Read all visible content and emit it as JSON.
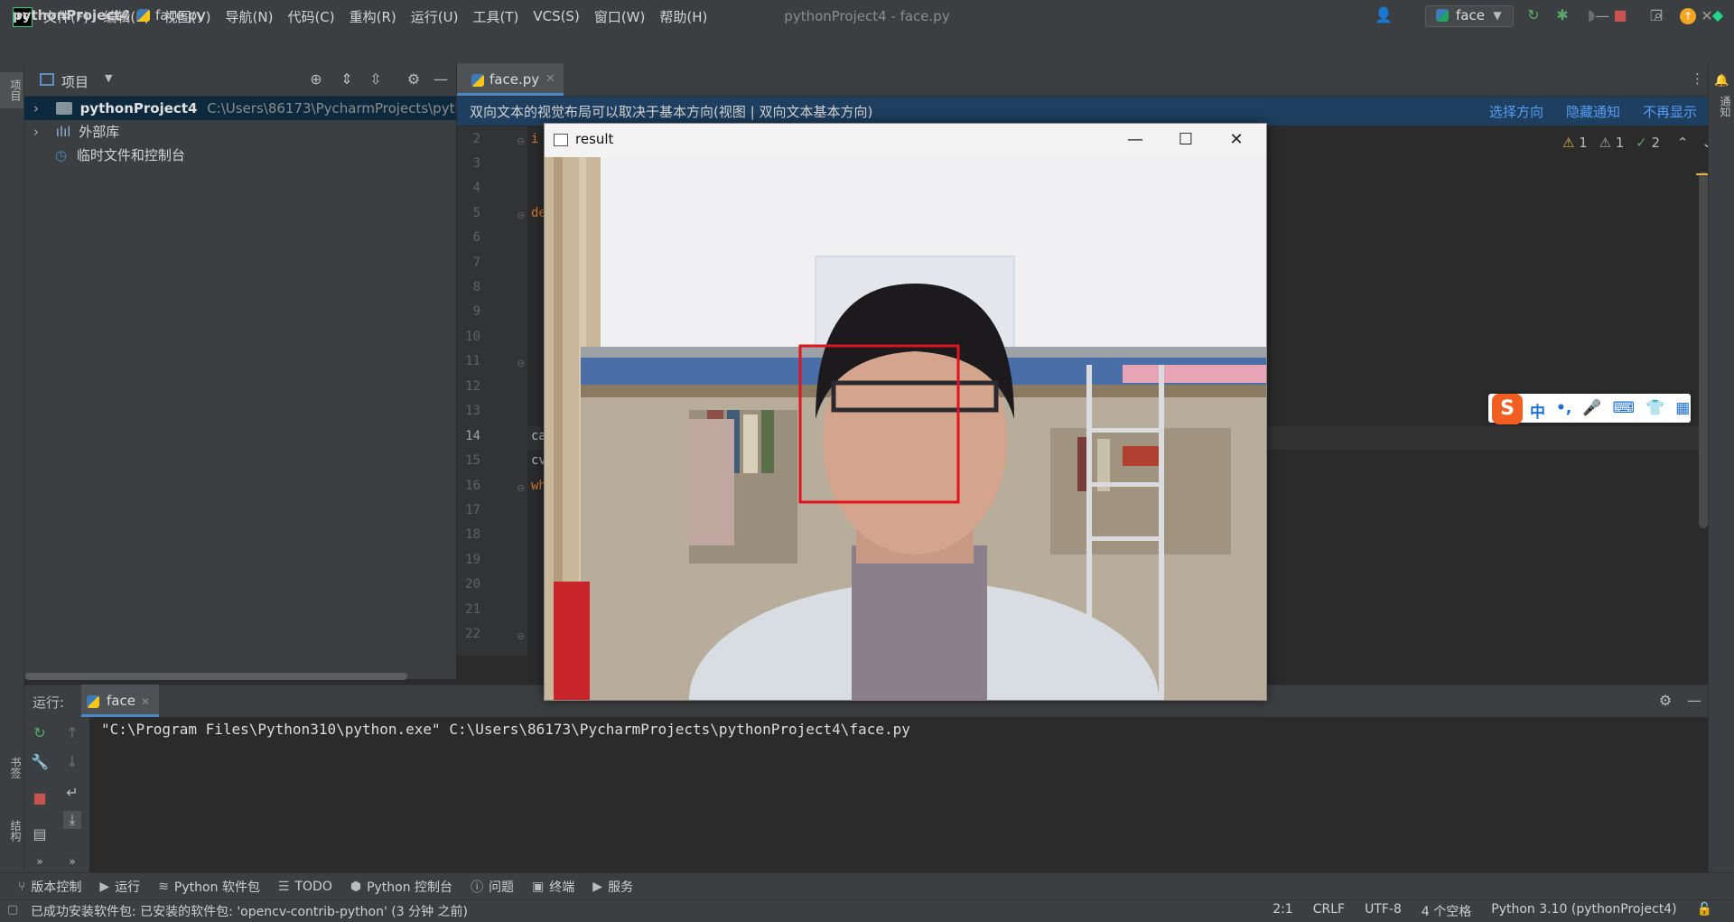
{
  "title_bar": {
    "logo": "PC",
    "menu": [
      "文件(F)",
      "编辑(E)",
      "视图(V)",
      "导航(N)",
      "代码(C)",
      "重构(R)",
      "运行(U)",
      "工具(T)",
      "VCS(S)",
      "窗口(W)",
      "帮助(H)"
    ],
    "window_title": "pythonProject4 - face.py"
  },
  "nav_bar": {
    "project": "pythonProject4",
    "separator": "〉",
    "file": "face.py",
    "run_config": "face"
  },
  "left_stripe": {
    "project": "项目",
    "bookmarks": "书签",
    "structure": "结构"
  },
  "right_stripe": {
    "notifications": "通知"
  },
  "project_panel": {
    "title": "项目",
    "tree": [
      {
        "name": "pythonProject4",
        "path": "C:\\Users\\86173\\PycharmProjects\\pythonP"
      },
      {
        "name": "外部库"
      },
      {
        "name": "临时文件和控制台"
      }
    ]
  },
  "editor": {
    "tab": "face.py",
    "notice": {
      "text": "双向文本的视觉布局可以取决于基本方向(视图 | 双向文本基本方向)",
      "actions": [
        "选择方向",
        "隐藏通知",
        "不再显示"
      ]
    },
    "line_numbers": [
      "2",
      "3",
      "4",
      "5",
      "6",
      "7",
      "8",
      "9",
      "10",
      "11",
      "12",
      "13",
      "14",
      "15",
      "16",
      "17",
      "18",
      "19",
      "20",
      "21",
      "22"
    ],
    "visible_code": {
      "l2": "i",
      "l5": "de",
      "l14": "ca",
      "l15": "cv",
      "l16": "wh"
    },
    "inspections": {
      "warn": "1",
      "weak": "1",
      "ok": "2"
    }
  },
  "cv_window": {
    "title": "result"
  },
  "run_panel": {
    "label": "运行:",
    "tab": "face",
    "console_line": "\"C:\\Program Files\\Python310\\python.exe\" C:\\Users\\86173\\PycharmProjects\\pythonProject4\\face.py"
  },
  "tool_windows": [
    "版本控制",
    "运行",
    "Python 软件包",
    "TODO",
    "Python 控制台",
    "问题",
    "终端",
    "服务"
  ],
  "status_bar": {
    "message": "已成功安装软件包: 已安装的软件包: 'opencv-contrib-python' (3 分钟 之前)",
    "position": "2:1",
    "line_sep": "CRLF",
    "encoding": "UTF-8",
    "indent": "4 个空格",
    "interpreter": "Python 3.10 (pythonProject4)"
  },
  "ime": {
    "logo": "S",
    "items": [
      "中",
      "•,",
      "🎤",
      "⌨",
      "👕",
      "▦"
    ]
  },
  "colors": {
    "accent": "#4a88c7",
    "face_box": "#e0141e",
    "link": "#589df6"
  }
}
